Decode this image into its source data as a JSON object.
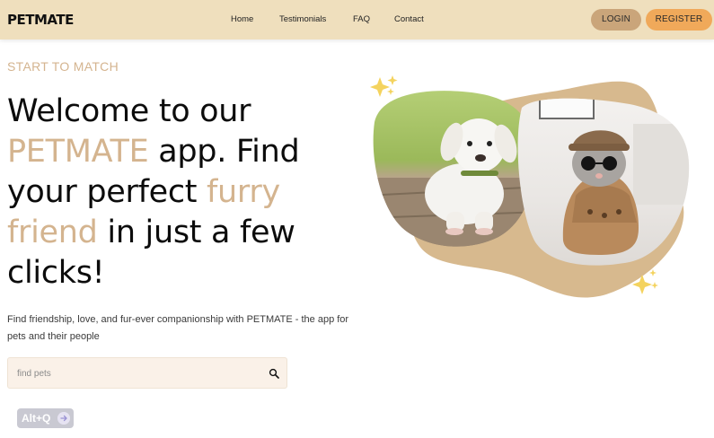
{
  "header": {
    "logo": "PETMATE",
    "nav": [
      "Home",
      "Testimonials",
      "FAQ",
      "Contact"
    ],
    "login_label": "LOGIN",
    "register_label": "REGISTER"
  },
  "hero": {
    "eyebrow": "START TO MATCH",
    "headline": {
      "l1": "Welcome to our",
      "l2_accent": "PETMATE",
      "l2_rest": " app. Find",
      "l3_text": "your perfect ",
      "l3_accent": "furry",
      "l4_accent": "friend",
      "l4_rest": " in just a few",
      "l5": "clicks!"
    },
    "subtext": "Find friendship, love, and fur-ever companionship with PETMATE - the app for pets and their people"
  },
  "search": {
    "placeholder": "find pets",
    "value": ""
  },
  "shortcut_badge": {
    "label": "Alt+Q"
  },
  "colors": {
    "header_bg": "#efdfbd",
    "accent": "#d4b48f",
    "login_btn": "#caa57a",
    "register_btn": "#f0a95a",
    "blob": "#d7b98e"
  },
  "icons": {
    "search": "search-icon",
    "sparkle": "sparkle-icon",
    "arrow": "arrow-right-icon"
  }
}
